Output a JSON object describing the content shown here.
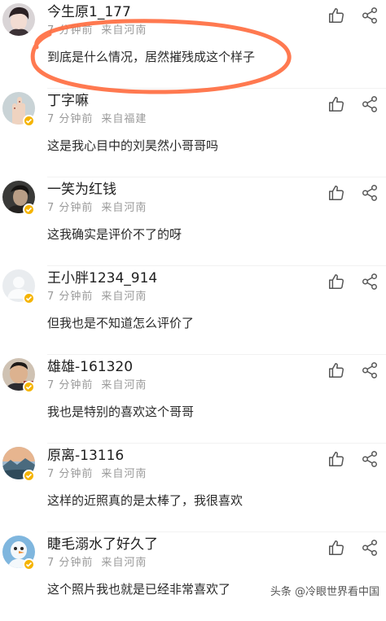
{
  "comments": [
    {
      "username": "今生原1_177",
      "time": "7 分钟前",
      "location": "来自河南",
      "text": "到底是什么情况，居然摧残成这个样子",
      "avatar": "avatar-boy",
      "verified": false
    },
    {
      "username": "丁字嘛",
      "time": "7 分钟前",
      "location": "来自福建",
      "text": "这是我心目中的刘昊然小哥哥吗",
      "avatar": "avatar-hand",
      "verified": true
    },
    {
      "username": "一笑为红钱",
      "time": "7 分钟前",
      "location": "来自河南",
      "text": "这我确实是评价不了的呀",
      "avatar": "avatar-dark",
      "verified": true
    },
    {
      "username": "王小胖1234_914",
      "time": "7 分钟前",
      "location": "来自河南",
      "text": "但我也是不知道怎么评价了",
      "avatar": "avatar-default",
      "verified": true
    },
    {
      "username": "雄雄-161320",
      "time": "7 分钟前",
      "location": "来自河南",
      "text": "我也是特别的喜欢这个哥哥",
      "avatar": "avatar-man",
      "verified": true
    },
    {
      "username": "原离-13116",
      "time": "7 分钟前",
      "location": "来自河南",
      "text": "这样的近照真的是太棒了，我很喜欢",
      "avatar": "avatar-landscape",
      "verified": true
    },
    {
      "username": "睫毛溺水了好久了",
      "time": "7 分钟前",
      "location": "来自河南",
      "text": "这个照片我也就是已经非常喜欢了",
      "avatar": "avatar-snowman",
      "verified": true
    }
  ],
  "watermark": "头条 @冷眼世界看中国",
  "colors": {
    "badge": "#f5b400",
    "highlight": "#ff6a3d",
    "meta": "#9a9a9a"
  }
}
